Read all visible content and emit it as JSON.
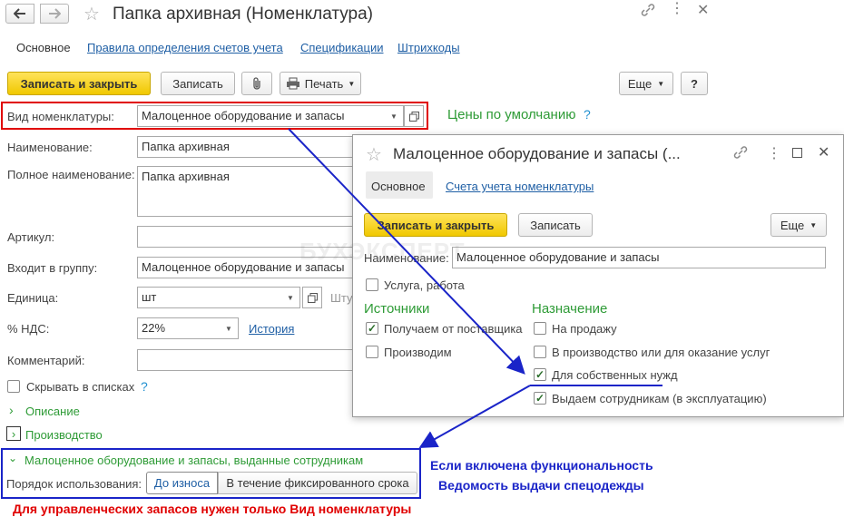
{
  "window": {
    "title": "Папка архивная (Номенклатура)"
  },
  "tabs": [
    {
      "label": "Основное"
    },
    {
      "label": "Правила определения счетов учета"
    },
    {
      "label": "Спецификации"
    },
    {
      "label": "Штрихкоды"
    }
  ],
  "toolbar": {
    "save_close": "Записать и закрыть",
    "save": "Записать",
    "print": "Печать",
    "more": "Еще",
    "help": "?"
  },
  "form": {
    "kind_label": "Вид номенклатуры:",
    "kind_value": "Малоценное оборудование и запасы",
    "prices_title": "Цены по умолчанию",
    "prices_help": "?",
    "name_label": "Наименование:",
    "name_value": "Папка архивная",
    "fullname_label": "Полное наименование:",
    "fullname_value": "Папка архивная",
    "article_label": "Артикул:",
    "group_label": "Входит в группу:",
    "group_value": "Малоценное оборудование и запасы",
    "unit_label": "Единица:",
    "unit_value": "шт",
    "unit_side": "Шту",
    "vat_label": "% НДС:",
    "vat_value": "22%",
    "vat_history": "История",
    "comment_label": "Комментарий:",
    "hide_label": "Скрывать в списках",
    "hide_help": "?",
    "desc_label": "Описание",
    "prod_label": "Производство",
    "lowvalue_title": "Малоценное оборудование и запасы, выданные сотрудникам",
    "usage_label": "Порядок использования:",
    "usage_opt1": "До износа",
    "usage_opt2": "В течение фиксированного срока"
  },
  "dialog": {
    "title": "Малоценное оборудование и запасы (...",
    "tab_main": "Основное",
    "tab_accounts": "Счета учета номенклатуры",
    "save_close": "Записать и закрыть",
    "save": "Записать",
    "more": "Еще",
    "name_label": "Наименование:",
    "name_value": "Малоценное оборудование и запасы",
    "service_label": "Услуга, работа",
    "sources_title": "Источники",
    "source_supplier": "Получаем от поставщика",
    "source_produce": "Производим",
    "purpose_title": "Назначение",
    "purpose_sale": "На продажу",
    "purpose_production": "В производство или для оказание услуг",
    "purpose_own": "Для собственных нужд",
    "purpose_employees": "Выдаем сотрудникам (в эксплуатацию)"
  },
  "checks": {
    "hide": false,
    "service": false,
    "source_supplier": true,
    "source_produce": false,
    "purpose_sale": false,
    "purpose_production": false,
    "purpose_own": true,
    "purpose_employees": true
  },
  "annotations": {
    "bottom_red": "Для управленческих запасов нужен только Вид номенклатуры",
    "blue_line1": "Если включена функциональность",
    "blue_line2": "Ведомость выдачи спецодежды"
  },
  "watermark": "БУХЭКСПЕРТ",
  "colors": {
    "accent_yellow": "#f5d000",
    "link_blue": "#1f5fa5",
    "section_green": "#2e9b36",
    "annot_red": "#e00000",
    "annot_blue": "#1a24c8"
  }
}
